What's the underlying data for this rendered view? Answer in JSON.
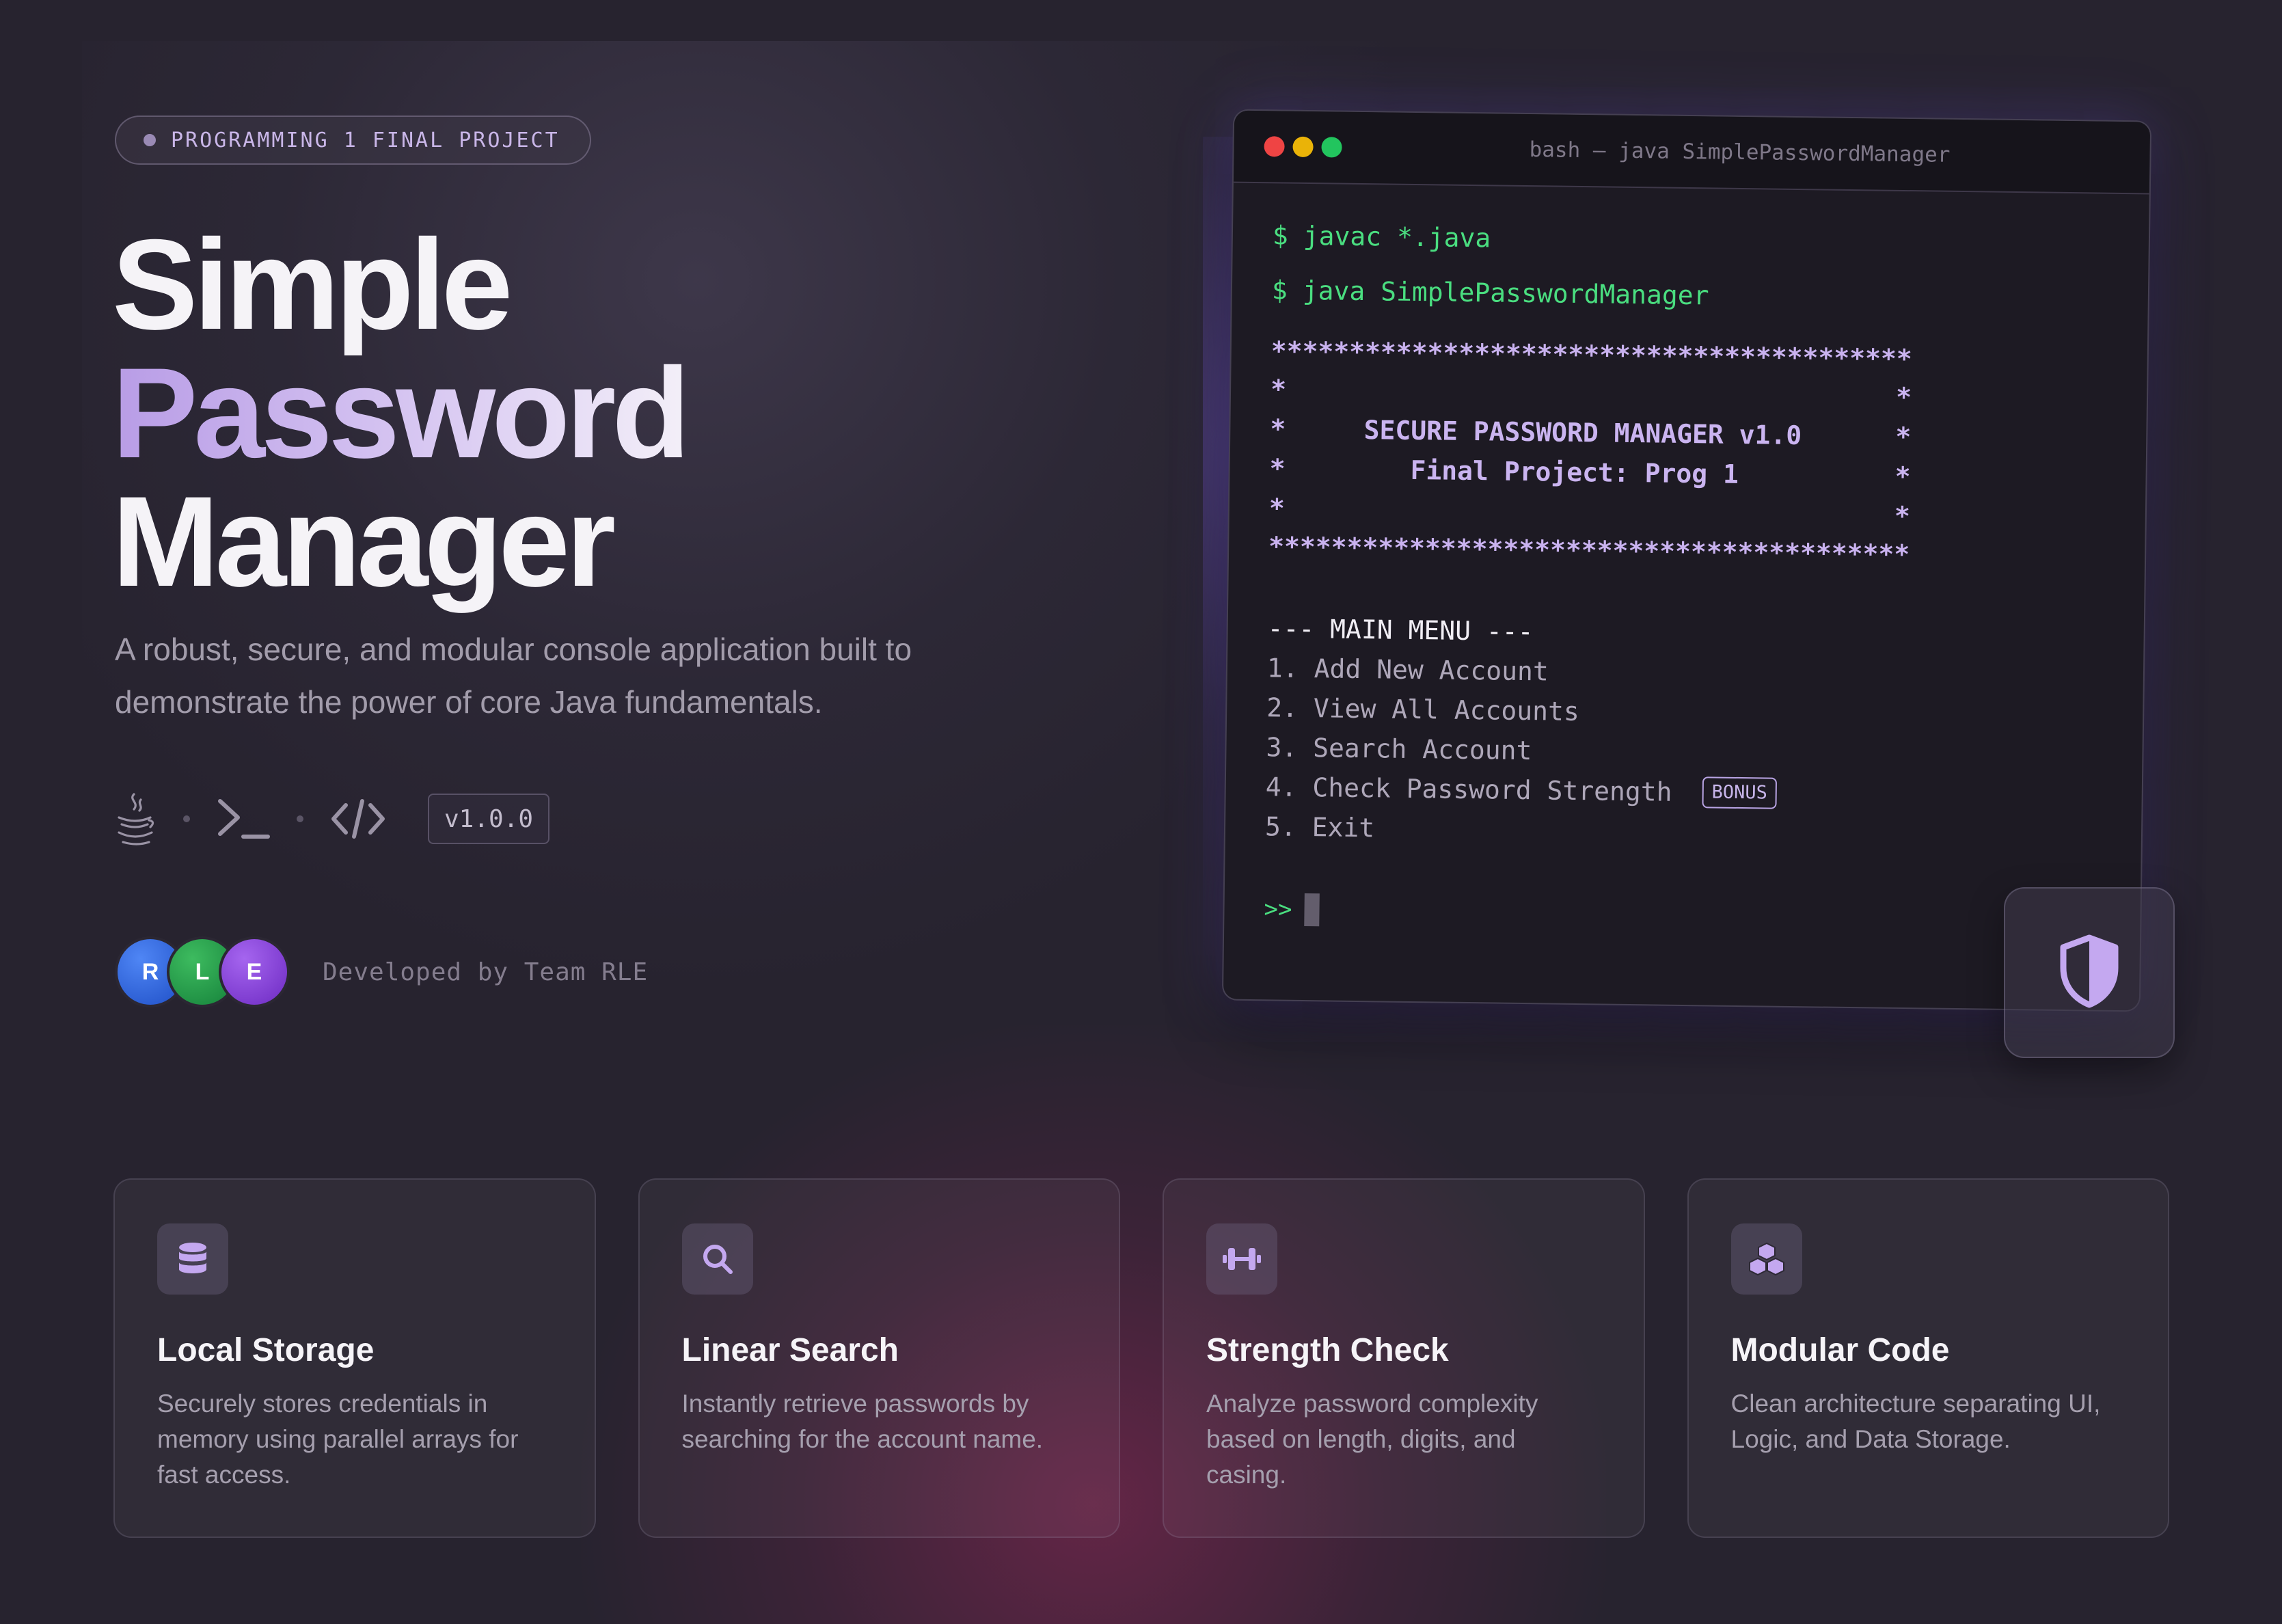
{
  "hero": {
    "tag": "PROGRAMMING 1 FINAL PROJECT",
    "title_line1": "Simple",
    "title_line2": "Password",
    "title_line3": "Manager",
    "subtitle": "A robust, secure, and modular console application built to demonstrate the power of core Java fundamentals.",
    "tech_icons": [
      "java-icon",
      "terminal-icon",
      "code-icon"
    ],
    "version": "v1.0.0"
  },
  "team": {
    "avatars": [
      "R",
      "L",
      "E"
    ],
    "label": "Developed by Team RLE"
  },
  "terminal": {
    "title": "bash — java SimplePasswordManager",
    "commands": [
      "javac *.java",
      "java SimplePasswordManager"
    ],
    "prompt_symbol": "$",
    "banner_border": "*****************************************",
    "banner_blank": "*                                       *",
    "banner_line1": "*     SECURE PASSWORD MANAGER v1.0      *",
    "banner_line2": "*        Final Project: Prog 1          *",
    "menu_header": "--- MAIN MENU ---",
    "menu_items": [
      "1. Add New Account",
      "2. View All Accounts",
      "3. Search Account",
      "4. Check Password Strength",
      "5. Exit"
    ],
    "bonus_badge": "BONUS",
    "input_prompt": ">>"
  },
  "features": [
    {
      "icon": "database-icon",
      "title": "Local Storage",
      "description": "Securely stores credentials in memory using parallel arrays for fast access."
    },
    {
      "icon": "search-icon",
      "title": "Linear Search",
      "description": "Instantly retrieve passwords by searching for the account name."
    },
    {
      "icon": "dumbbell-icon",
      "title": "Strength Check",
      "description": "Analyze password complexity based on length, digits, and casing."
    },
    {
      "icon": "cubes-icon",
      "title": "Modular Code",
      "description": "Clean architecture separating UI, Logic, and Data Storage."
    }
  ],
  "colors": {
    "background": "#27232f",
    "accent_purple": "#b89ce6",
    "terminal_green": "#4ade80",
    "terminal_bg": "#1d1a23"
  }
}
